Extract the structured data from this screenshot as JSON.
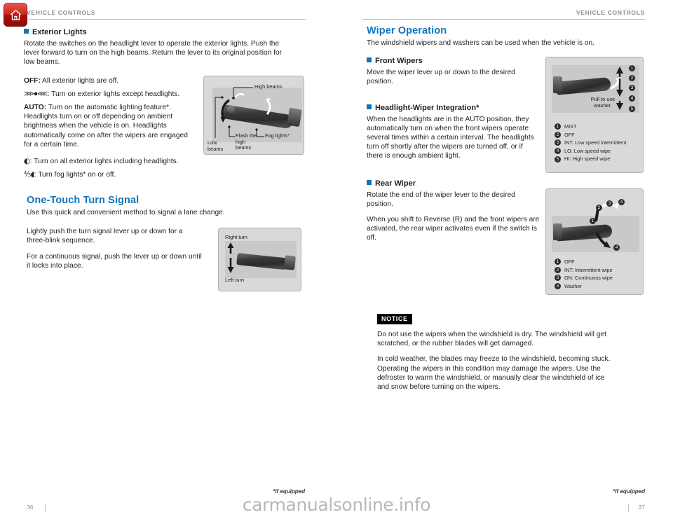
{
  "document": {
    "running_head_left": "VEHICLE CONTROLS",
    "running_head_right": "VEHICLE CONTROLS",
    "watermark": "carmanualsonline.info"
  },
  "home_button": {
    "icon": "home-icon",
    "color": "#c0281f"
  },
  "left_page": {
    "folio": "36",
    "if_equipped": "*if equipped",
    "sections": [
      {
        "heading": "Exterior Lights",
        "type": "sub",
        "paragraphs": [
          "Rotate the switches on the headlight lever to operate the exterior lights. Push the lever forward to turn on the high beams. Return the lever to its original position for low beams."
        ],
        "items": [
          {
            "label": "OFF:",
            "symbol": "",
            "text": " All exterior lights are off."
          },
          {
            "label": "",
            "symbol": "parking-lights-symbol",
            "text": ": Turn on exterior lights except headlights."
          },
          {
            "label": "AUTO:",
            "symbol": "",
            "text": " Turn on the automatic lighting feature*. Headlights turn on or off depending on ambient brightness when the vehicle is on. Headlights automatically come on after the wipers are engaged for a certain time."
          },
          {
            "label": "",
            "symbol": "headlight-symbol",
            "text": ": Turn on all exterior lights including headlights."
          },
          {
            "label": "",
            "symbol": "fog-light-symbol",
            "text": ": Turn fog lights* on or off."
          }
        ]
      },
      {
        "heading": "One-Touch Turn Signal",
        "type": "main",
        "lead": "Use this quick and convenient method to signal a lane change.",
        "paragraphs": [
          "Lightly push the turn signal lever up or down for a three-blink sequence.",
          "For a continuous signal, push the lever up or down until it locks into place."
        ]
      }
    ],
    "figures": [
      {
        "name": "headlight-lever-figure",
        "captions": [
          "High beams",
          "Fog lights*",
          "Flash the high beams",
          "Low beams"
        ]
      },
      {
        "name": "turn-signal-lever-figure",
        "captions": [
          "Right turn",
          "Left turn"
        ]
      }
    ]
  },
  "right_page": {
    "folio": "37",
    "if_equipped": "*if equipped",
    "title": "Wiper Operation",
    "lead": "The windshield wipers and washers can be used when the vehicle is on.",
    "sections": [
      {
        "heading": "Front Wipers",
        "paragraphs": [
          "Move the wiper lever up or down to the desired position."
        ]
      },
      {
        "heading": "Headlight-Wiper Integration*",
        "paragraphs": [
          "When the headlights are in the AUTO position, they automatically turn on when the front wipers operate several times within a certain interval. The headlights turn off shortly after the wipers are turned off, or if there is enough ambient light."
        ]
      },
      {
        "heading": "Rear Wiper",
        "paragraphs": [
          "Rotate the end of the wiper lever to the desired position.",
          "When you shift to Reverse (R) and the front wipers are activated, the rear wiper activates even if the switch is off."
        ]
      }
    ],
    "figures": [
      {
        "name": "front-wiper-lever-figure",
        "caption": "Pull to use washer.",
        "legend": [
          {
            "num": "1",
            "text": "MIST"
          },
          {
            "num": "2",
            "text": "OFF"
          },
          {
            "num": "3",
            "text": "INT: Low speed intermittent"
          },
          {
            "num": "4",
            "text": "LO: Low speed wipe"
          },
          {
            "num": "5",
            "text": "HI: High speed wipe"
          }
        ]
      },
      {
        "name": "rear-wiper-lever-figure",
        "legend": [
          {
            "num": "1",
            "text": "OFF"
          },
          {
            "num": "2",
            "text": "INT: Intermittent wipe"
          },
          {
            "num": "3",
            "text": "ON: Continuous wipe"
          },
          {
            "num": "4",
            "text": "Washer"
          }
        ]
      }
    ],
    "notice": {
      "tag": "NOTICE",
      "paragraphs": [
        "Do not use the wipers when the windshield is dry. The windshield will get scratched, or the rubber blades will get damaged.",
        "In cold weather, the blades may freeze to the windshield, becoming stuck. Operating the wipers in this condition may damage the wipers. Use the defroster to warm the windshield, or manually clear the windshield of ice and snow before turning on the wipers."
      ]
    }
  }
}
